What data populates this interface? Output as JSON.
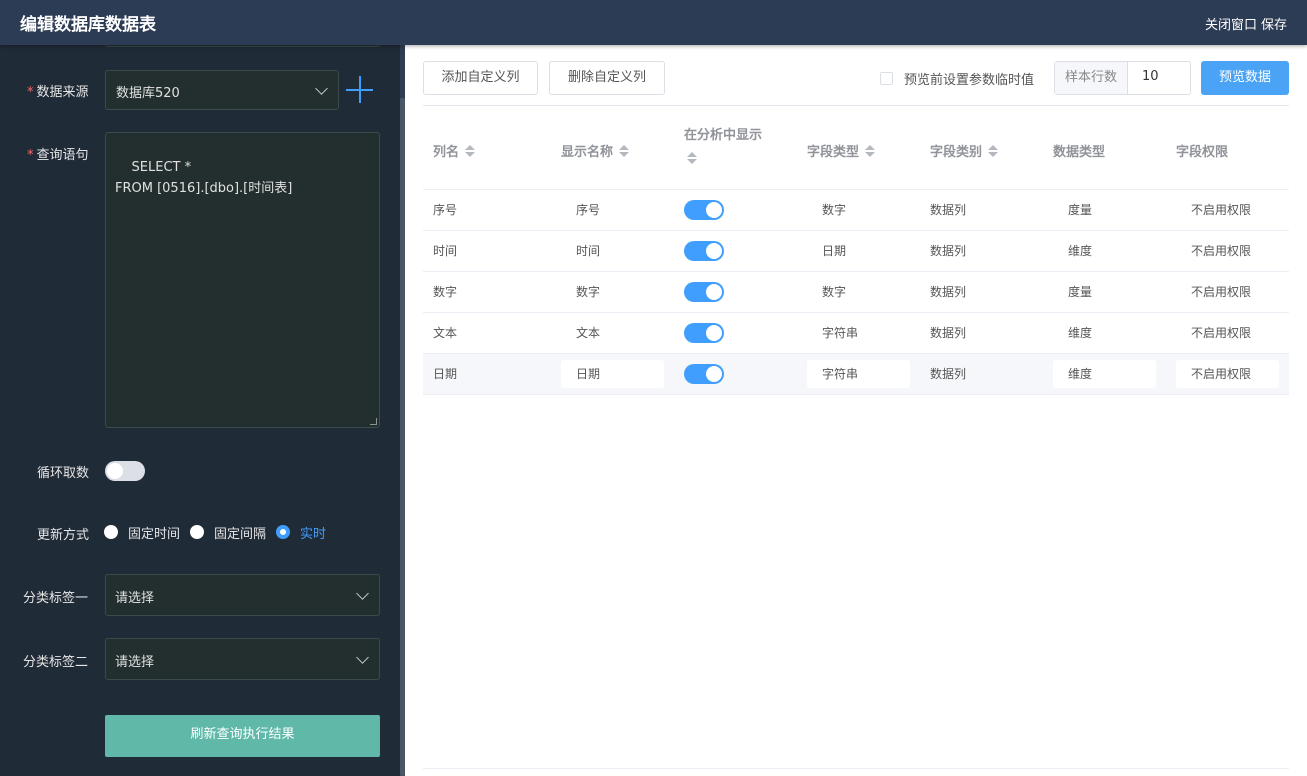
{
  "header": {
    "title": "编辑数据库数据表",
    "close_label": "关闭窗口",
    "save_label": "保存"
  },
  "form": {
    "datasource": {
      "label": "数据来源",
      "value": "数据库520"
    },
    "query": {
      "label": "查询语句",
      "value": "SELECT *\nFROM [0516].[dbo].[时间表]"
    },
    "loop": {
      "label": "循环取数",
      "on": false
    },
    "update": {
      "label": "更新方式",
      "options": [
        "固定时间",
        "固定间隔",
        "实时"
      ],
      "selected": "实时"
    },
    "category1": {
      "label": "分类标签一",
      "placeholder": "请选择"
    },
    "category2": {
      "label": "分类标签二",
      "placeholder": "请选择"
    },
    "refresh_label": "刷新查询执行结果"
  },
  "toolbar": {
    "add_column": "添加自定义列",
    "delete_column": "删除自定义列",
    "param_checkbox": "预览前设置参数临时值",
    "sample_label": "样本行数",
    "sample_value": "10",
    "preview": "预览数据"
  },
  "table": {
    "headers": [
      "列名",
      "显示名称",
      "在分析中显示",
      "字段类型",
      "字段类别",
      "数据类型",
      "字段权限"
    ],
    "rows": [
      {
        "name": "序号",
        "display": "序号",
        "show": true,
        "field_type": "数字",
        "field_cat": "数据列",
        "data_type": "度量",
        "perm": "不启用权限"
      },
      {
        "name": "时间",
        "display": "时间",
        "show": true,
        "field_type": "日期",
        "field_cat": "数据列",
        "data_type": "维度",
        "perm": "不启用权限"
      },
      {
        "name": "数字",
        "display": "数字",
        "show": true,
        "field_type": "数字",
        "field_cat": "数据列",
        "data_type": "度量",
        "perm": "不启用权限"
      },
      {
        "name": "文本",
        "display": "文本",
        "show": true,
        "field_type": "字符串",
        "field_cat": "数据列",
        "data_type": "维度",
        "perm": "不启用权限"
      },
      {
        "name": "日期",
        "display": "日期",
        "show": true,
        "field_type": "字符串",
        "field_cat": "数据列",
        "data_type": "维度",
        "perm": "不启用权限"
      }
    ]
  }
}
